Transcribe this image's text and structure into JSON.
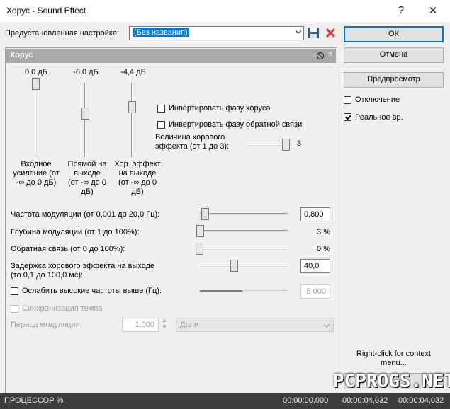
{
  "window": {
    "title": "Хорус - Sound Effect",
    "help_glyph": "?",
    "close_glyph": "✕"
  },
  "preset": {
    "label": "Предустановленная настройка:",
    "value": "(Без названия)"
  },
  "buttons": {
    "ok": "ОК",
    "cancel": "Отмена",
    "preview": "Предпросмотр"
  },
  "options": {
    "bypass": {
      "label": "Отключение",
      "checked": false
    },
    "realtime": {
      "label": "Реальное вр.",
      "checked": true
    }
  },
  "panel": {
    "title": "Хорус",
    "help_glyph": "?"
  },
  "vsliders": [
    {
      "value": "0,0 дБ",
      "caption": [
        "Входное",
        "усиление (от",
        "-∞ до 0 дБ)"
      ],
      "level": 1.0
    },
    {
      "value": "-6,0 дБ",
      "caption": [
        "Прямой на",
        "выходе",
        "(от -∞ до 0",
        "дБ)"
      ],
      "level": 0.5
    },
    {
      "value": "-4,4 дБ",
      "caption": [
        "Хор. эффект",
        "на выходе",
        "(от -∞ до 0",
        "дБ)"
      ],
      "level": 0.6
    }
  ],
  "invert_chorus": {
    "label": "Инвертировать фазу хоруса",
    "checked": false
  },
  "invert_feedback": {
    "label": "Инвертировать фазу обратной связи",
    "checked": false
  },
  "chorus_amount": {
    "label": [
      "Величина хорового",
      "эффекта (от 1 до 3):"
    ],
    "value": "3"
  },
  "params": [
    {
      "label": "Частота модуляции (от 0,001 до 20,0 Гц):",
      "value": "0,800",
      "type": "box"
    },
    {
      "label": "Глубина модуляции (от 1 до 100%):",
      "value": "3 %",
      "type": "text"
    },
    {
      "label": "Обратная связь (от 0 до 100%):",
      "value": "0 %",
      "type": "text"
    },
    {
      "label": [
        "Задержка хорового эффекта на выходе",
        "(то 0,1 до 100,0 мс):"
      ],
      "value": "40,0",
      "type": "box"
    }
  ],
  "highcut": {
    "label": "Ослабить высокие частоты выше (Гц):",
    "value": "5 000",
    "checked": false
  },
  "tempo_sync": {
    "label": "Синхронизация темпа",
    "checked": false
  },
  "mod_period": {
    "label": "Период модуляции:",
    "value": "1,000",
    "unit": "Доли"
  },
  "context_hint": [
    "Right-click for context",
    "menu..."
  ],
  "statusbar": {
    "cpu": "ПРОЦЕССОР %",
    "t1": "00:00:00,000",
    "t2": "00:00:04,032",
    "t3": "00:00:04,032"
  },
  "watermark": "PCPROGS.NET",
  "colors": {
    "accent": "#0078d7",
    "delete": "#d83b3b",
    "panel_header": "#a9a9a9",
    "status_bg": "#3c3c3c"
  }
}
